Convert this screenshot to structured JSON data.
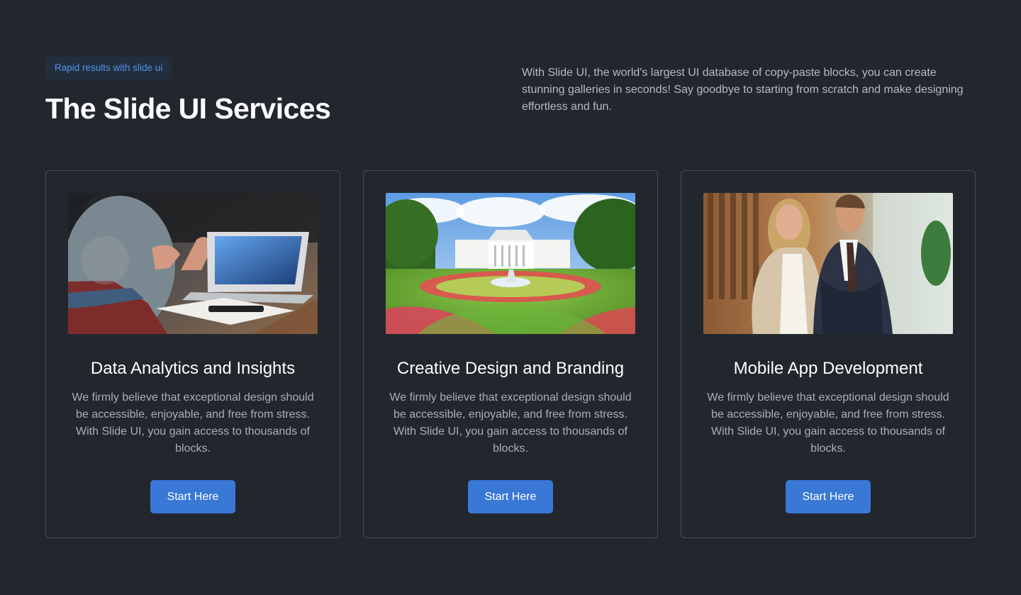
{
  "hero": {
    "badge": "Rapid results with slide ui",
    "title": "The Slide UI Services",
    "description": "With Slide UI, the world's largest UI database of copy-paste blocks, you can create stunning galleries in seconds! Say goodbye to starting from scratch and make designing effortless and fun."
  },
  "cards": [
    {
      "title": "Data Analytics and Insights",
      "text": "We firmly believe that exceptional design should be accessible, enjoyable, and free from stress. With Slide UI, you gain access to thousands of blocks.",
      "button": "Start Here"
    },
    {
      "title": "Creative Design and Branding",
      "text": "We firmly believe that exceptional design should be accessible, enjoyable, and free from stress. With Slide UI, you gain access to thousands of blocks.",
      "button": "Start Here"
    },
    {
      "title": "Mobile App Development",
      "text": "We firmly believe that exceptional design should be accessible, enjoyable, and free from stress. With Slide UI, you gain access to thousands of blocks.",
      "button": "Start Here"
    }
  ],
  "colors": {
    "background": "#22272e",
    "accent": "#3a78d6",
    "badge_text": "#4f93ea",
    "border": "#454c56"
  }
}
